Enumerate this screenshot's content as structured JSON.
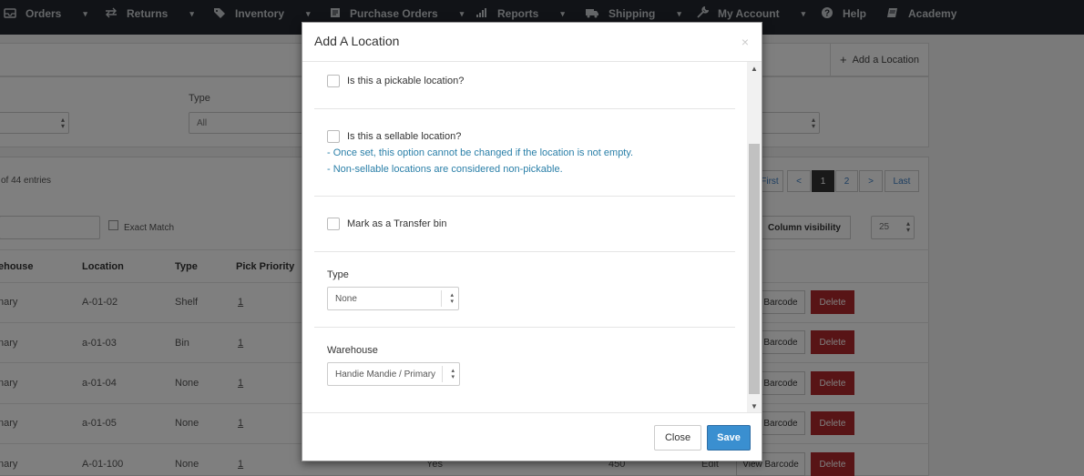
{
  "nav": {
    "items": [
      {
        "label": "Orders",
        "icon": "inbox-icon"
      },
      {
        "label": "Returns",
        "icon": "exchange-icon"
      },
      {
        "label": "Inventory",
        "icon": "tag-icon"
      },
      {
        "label": "Purchase Orders",
        "icon": "document-icon"
      },
      {
        "label": "Reports",
        "icon": "bar-chart-icon"
      },
      {
        "label": "Shipping",
        "icon": "truck-icon"
      },
      {
        "label": "My Account",
        "icon": "wrench-icon"
      },
      {
        "label": "Help",
        "icon": "question-icon"
      },
      {
        "label": "Academy",
        "icon": "book-icon"
      }
    ]
  },
  "page": {
    "add_button": "Add a Location",
    "type_label": "Type",
    "type_value": "All",
    "entries_text": "of 44 entries",
    "exact_match": "Exact Match",
    "column_visibility": "Column visibility",
    "page_size": "25",
    "pager": [
      "First",
      "<",
      "1",
      "2",
      ">",
      "Last"
    ],
    "columns": [
      "ehouse",
      "Location",
      "Type",
      "Pick Priority"
    ],
    "rows": [
      {
        "warehouse": "nary",
        "location": "A-01-02",
        "type": "Shelf",
        "priority": "1"
      },
      {
        "warehouse": "nary",
        "location": "a-01-03",
        "type": "Bin",
        "priority": "1"
      },
      {
        "warehouse": "nary",
        "location": "a-01-04",
        "type": "None",
        "priority": "1"
      },
      {
        "warehouse": "nary",
        "location": "a-01-05",
        "type": "None",
        "priority": "1"
      },
      {
        "warehouse": "nary",
        "location": "A-01-100",
        "type": "None",
        "priority": "1"
      }
    ],
    "row_extra": {
      "yes": "Yes",
      "qty": "450",
      "edit": "Edit"
    },
    "barcode_label": "Barcode",
    "view_barcode_label": "View Barcode",
    "delete_label": "Delete"
  },
  "modal": {
    "title": "Add A Location",
    "close_x": "×",
    "pickable_label": "Is this a pickable location?",
    "sellable_label": "Is this a sellable location?",
    "sellable_note_1": "- Once set, this option cannot be changed if the location is not empty.",
    "sellable_note_2": "- Non-sellable locations are considered non-pickable.",
    "transfer_label": "Mark as a Transfer bin",
    "type_label": "Type",
    "type_value": "None",
    "warehouse_label": "Warehouse",
    "warehouse_value": "Handie Mandie / Primary",
    "close_button": "Close",
    "save_button": "Save"
  },
  "colors": {
    "nav_bg": "#22272e",
    "note_blue": "#2a7fa8",
    "save_blue": "#3a8fd0",
    "delete_red": "#b0292c"
  }
}
